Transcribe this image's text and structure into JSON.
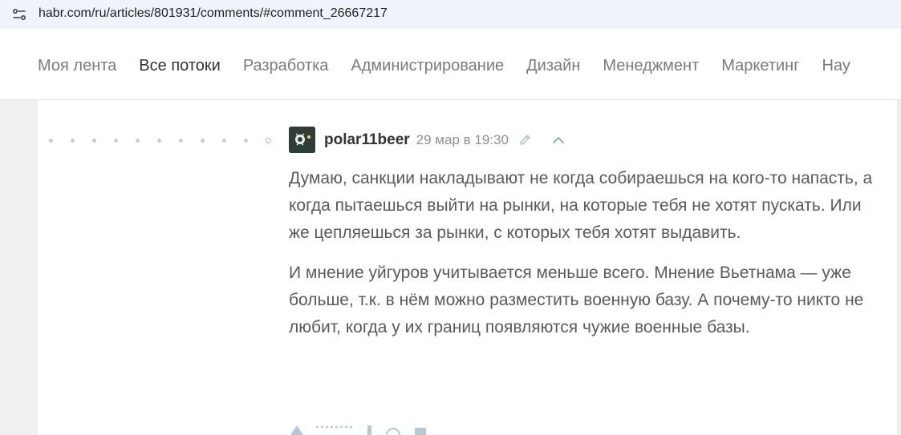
{
  "browser": {
    "url": "habr.com/ru/articles/801931/comments/#comment_26667217"
  },
  "nav": {
    "items": [
      {
        "label": "Моя лента",
        "active": false
      },
      {
        "label": "Все потоки",
        "active": true
      },
      {
        "label": "Разработка",
        "active": false
      },
      {
        "label": "Администрирование",
        "active": false
      },
      {
        "label": "Дизайн",
        "active": false
      },
      {
        "label": "Менеджмент",
        "active": false
      },
      {
        "label": "Маркетинг",
        "active": false
      },
      {
        "label": "Нау",
        "active": false
      }
    ]
  },
  "comment": {
    "username": "polar11beer",
    "timestamp": "29 мар в 19:30",
    "paragraphs": [
      "Думаю, санкции накладывают не когда собираешься на кого-то напасть, а когда пытаешься выйти на рынки, на которые тебя не хотят пускать. Или же цепляешься за рынки, с которых тебя хотят выдавить.",
      "И мнение уйгуров учитывается меньше всего. Мнение Вьетнама — уже больше, т.к. в нём можно разместить военную базу. А почему-то никто не любит, когда у их границ появляются чужие военные базы."
    ],
    "icons": {
      "edit": "pencil-icon",
      "parent": "chevron-up-icon"
    }
  },
  "colors": {
    "accent": "#548eaa",
    "text": "#5a5a5a",
    "nav_inactive": "#7b7b7b"
  }
}
